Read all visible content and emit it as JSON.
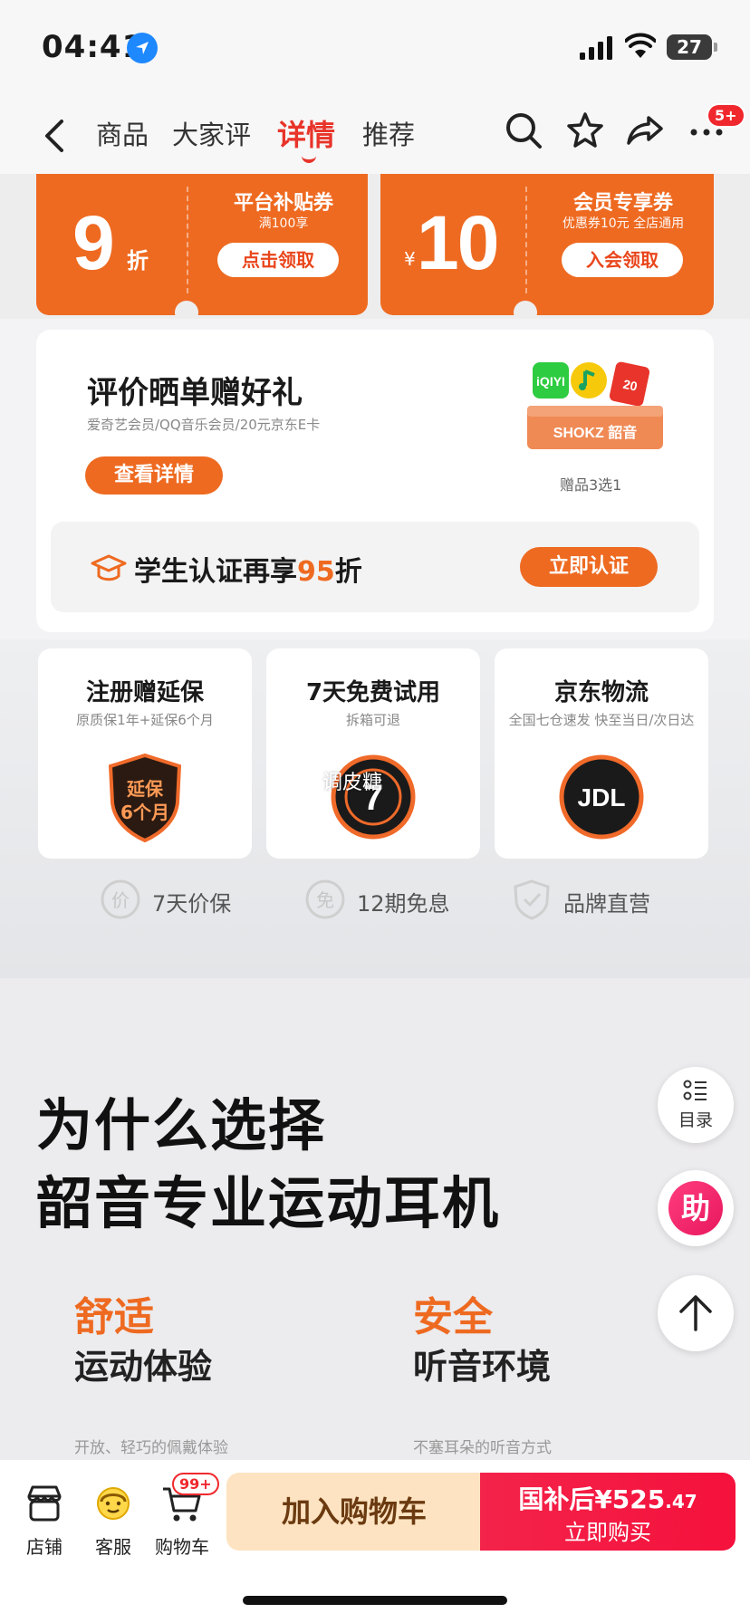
{
  "status": {
    "time": "04:41",
    "battery": "27"
  },
  "nav": {
    "tabs": [
      "商品",
      "大家评",
      "详情",
      "推荐"
    ],
    "active_tab": "详情",
    "badge": "5+"
  },
  "coupons": [
    {
      "value": "9",
      "unit": "折",
      "title": "平台补贴券",
      "sub": "满100享",
      "button": "点击领取"
    },
    {
      "currency": "¥",
      "value": "10",
      "title": "会员专享券",
      "sub": "优惠券10元 全店通用",
      "button": "入会领取"
    }
  ],
  "review": {
    "title": "评价晒单赠好礼",
    "sub": "爱奇艺会员/QQ音乐会员/20元京东E卡",
    "button": "查看详情",
    "gift_brand": "SHOKZ 韶音",
    "gift_note": "赠品3选1"
  },
  "student": {
    "text_prefix": "学生认证再享",
    "highlight": "95",
    "text_suffix": "折",
    "button": "立即认证"
  },
  "features": [
    {
      "title": "注册赠延保",
      "sub": "原质保1年+延保6个月",
      "icon_text": "延保\n6个月"
    },
    {
      "title": "7天免费试用",
      "sub": "拆箱可退",
      "icon_text": "7"
    },
    {
      "title": "京东物流",
      "sub": "全国七仓速发 快至当日/次日达",
      "icon_text": "JDL"
    }
  ],
  "watermark": "调皮糖",
  "assurances": [
    {
      "icon": "价",
      "label": "7天价保"
    },
    {
      "icon": "免",
      "label": "12期免息"
    },
    {
      "icon": "shield-check-icon",
      "label": "品牌直营"
    }
  ],
  "why": {
    "line1": "为什么选择",
    "line2": "韶音专业运动耳机",
    "cols": [
      {
        "title": "舒适",
        "sub": "运动体验",
        "desc": "开放、轻巧的佩戴体验"
      },
      {
        "title": "安全",
        "sub": "听音环境",
        "desc": "不塞耳朵的听音方式"
      }
    ]
  },
  "floating": {
    "catalog": "目录",
    "helper": "助"
  },
  "bottom": {
    "store": "店铺",
    "service": "客服",
    "cart": "购物车",
    "cart_badge": "99+",
    "add_cart": "加入购物车",
    "price_label": "国补后¥525",
    "price_decimal": ".47",
    "buy": "立即购买"
  },
  "colors": {
    "accent": "#ee6a21",
    "active_tab": "#e8342a",
    "buy": "#f3234a"
  }
}
